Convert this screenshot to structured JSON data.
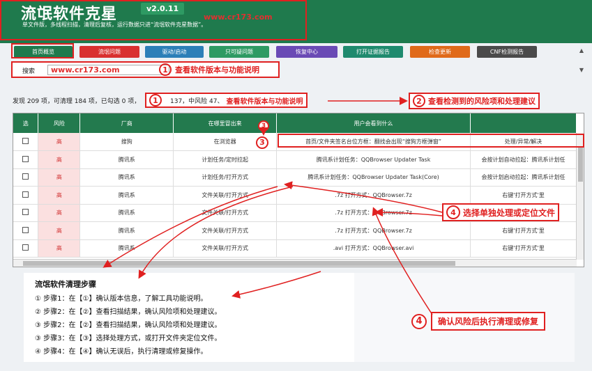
{
  "header": {
    "title": "流氓软件克星",
    "version": "v2.0.11",
    "url_watermark": "www.cr173.com",
    "subtitle": "单文件版，多线程扫描，清理后复核，运行数据只进“流氓软件克星数据”。"
  },
  "tabs": [
    {
      "label": "首页概览",
      "color": "#1f7a4d"
    },
    {
      "label": "流氓问题",
      "color": "#d93030"
    },
    {
      "label": "驱动/启动",
      "color": "#2c7fb8"
    },
    {
      "label": "只可疑问题",
      "color": "#2e9a63"
    },
    {
      "label": "恢复中心",
      "color": "#6a4ab5"
    },
    {
      "label": "打开证据报告",
      "color": "#1f8a6e"
    },
    {
      "label": "检查更新",
      "color": "#e06a1a"
    },
    {
      "label": "CNF检测报告",
      "color": "#4a4a4a"
    }
  ],
  "search": {
    "label": "搜索",
    "value": "www.cr173.com",
    "callout_num": "1",
    "callout_text": "查看软件版本与功能说明"
  },
  "stats": {
    "text": "发现 209 项，可清理 184 项，已勾选 0 项，",
    "suffix": "137，中风险 47、",
    "callout_num": "1",
    "callout_text": "查看软件版本与功能说明"
  },
  "callouts": {
    "c2_num": "2",
    "c2_text": "查看检测到的风险项和处理建议",
    "c3_num": "3",
    "c4_num": "4",
    "c4_text": "选择单独处理或定位文件",
    "c4b_num": "4",
    "c4b_text": "确认风险后执行清理或修复"
  },
  "table": {
    "headers": [
      "选",
      "风险",
      "厂商",
      "在哪里冒出来",
      "用户会看到什么",
      ""
    ],
    "rows": [
      {
        "risk": "高",
        "vendor": "搜狗",
        "where": "在浏览器",
        "seen": "首页/文件夹签名台位方框：翻找会出现“搜狗方框弹窗”",
        "extra": "处理/异常/解决"
      },
      {
        "risk": "高",
        "vendor": "腾讯系",
        "where": "计划任务/定时拉起",
        "seen": "腾讯系计划任务：QQBrowser Updater Task",
        "extra": "会按计划自动拉起：腾讯系计划任"
      },
      {
        "risk": "高",
        "vendor": "腾讯系",
        "where": "计划任务/打开方式",
        "seen": "腾讯系计划任务：QQBrowser Updater Task(Core)",
        "extra": "会按计划启动拉起：腾讯系计划任"
      },
      {
        "risk": "高",
        "vendor": "腾讯系",
        "where": "文件关联/打开方式",
        "seen": ".7z 打开方式：QQBrowser.7z",
        "extra": "右键'打开方式'里"
      },
      {
        "risk": "高",
        "vendor": "腾讯系",
        "where": "文件关联/打开方式",
        "seen": ".7z 打开方式：QQBrowser.7z",
        "extra": "右键'打开方式'里"
      },
      {
        "risk": "高",
        "vendor": "腾讯系",
        "where": "文件关联/打开方式",
        "seen": ".7z 打开方式：QQBrowser.7z",
        "extra": "右键'打开方式'里"
      },
      {
        "risk": "高",
        "vendor": "腾讯系",
        "where": "文件关联/打开方式",
        "seen": ".avi 打开方式：QQBrowser.avi",
        "extra": "右键'打开方式'里"
      }
    ]
  },
  "steps": {
    "title": "流氓软件清理步骤",
    "lines": [
      "① 步骤1：在【①】确认版本信息，了解工具功能说明。",
      "② 步骤2：在【②】查看扫描结果，确认风险项和处理建议。",
      "③ 步骤2：在【②】查看扫描结果，确认风险项和处理建议。",
      "③ 步骤3：在【③】选择处理方式，或打开文件夹定位文件。",
      "④ 步骤4：在【④】确认无误后，执行清理或修复操作。"
    ]
  }
}
